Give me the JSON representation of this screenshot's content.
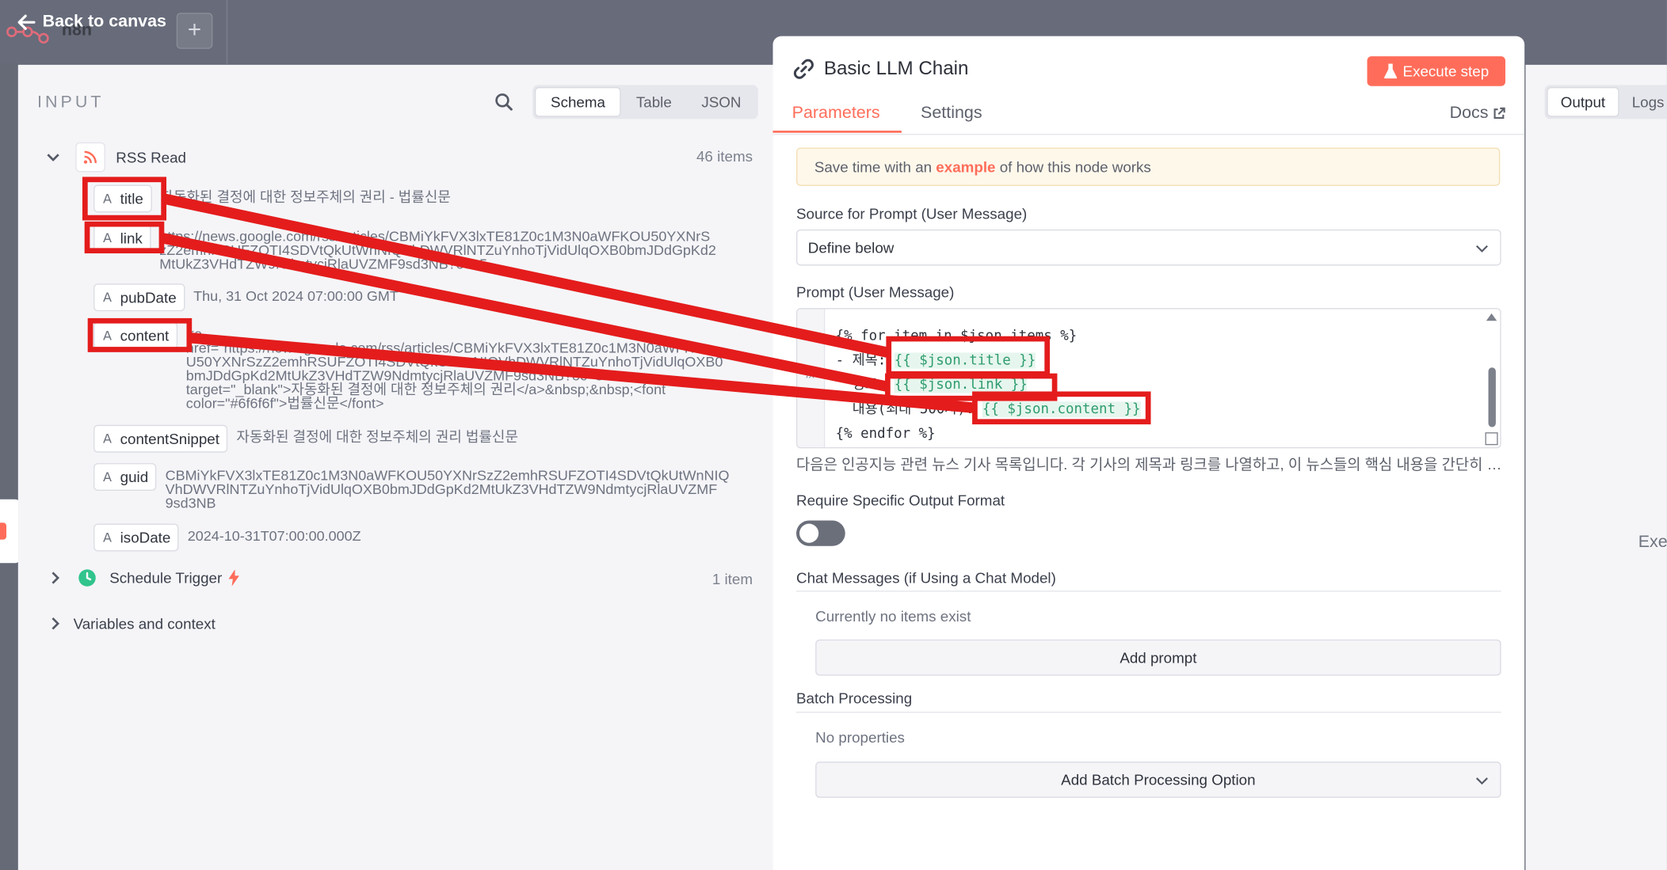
{
  "topbar": {
    "back_label": "Back to canvas",
    "app_name": "n8n",
    "plus_label": "+"
  },
  "input_panel": {
    "title": "INPUT",
    "view_tabs": [
      "Schema",
      "Table",
      "JSON"
    ],
    "active_view": "Schema",
    "rss": {
      "name": "RSS Read",
      "count": "46 items",
      "fields": [
        {
          "key": "title",
          "value": "자동화된 결정에 대한 정보주체의 권리 - 법률신문"
        },
        {
          "key": "link",
          "value": "https://news.google.com/rss/articles/CBMiYkFVX3lxTE81Z0c1M3N0aWFKOU50YXNrS\nzZ2emhRSUFZOTI4SDVtQkUtWnNIQVhDWVRlNTZuYnhoTjVidUlqOXB0bmJDdGpKd2\nMtUkZ3VHdTZW9NdmtycjRlaUVZMF9sd3NB?oc=5"
        },
        {
          "key": "pubDate",
          "value": "Thu, 31 Oct 2024 07:00:00 GMT"
        },
        {
          "key": "content",
          "value": "<a\nhref=\"https://news.google.com/rss/articles/CBMiYkFVX3lxTE81Z0c1M3N0aWFKO\nU50YXNrSzZ2emhRSUFZOTI4SDVtQkUtWnNIQVhDWVRlNTZuYnhoTjVidUlqOXB0\nbmJDdGpKd2MtUkZ3VHdTZW9NdmtycjRlaUVZMF9sd3NB?oc=5\"\ntarget=\"_blank\">자동화된 결정에 대한 정보주체의 권리</a>&nbsp;&nbsp;<font\ncolor=\"#6f6f6f\">법률신문</font>"
        },
        {
          "key": "contentSnippet",
          "value": "자동화된 결정에 대한 정보주체의 권리  법률신문"
        },
        {
          "key": "guid",
          "value": "CBMiYkFVX3lxTE81Z0c1M3N0aWFKOU50YXNrSzZ2emhRSUFZOTI4SDVtQkUtWnNIQ\nVhDWVRlNTZuYnhoTjVidUlqOXB0bmJDdGpKd2MtUkZ3VHdTZW9NdmtycjRlaUVZMF\n9sd3NB"
        },
        {
          "key": "isoDate",
          "value": "2024-10-31T07:00:00.000Z"
        }
      ]
    },
    "schedule": {
      "name": "Schedule Trigger",
      "count": "1 item"
    },
    "variables_label": "Variables and context"
  },
  "node": {
    "title": "Basic LLM Chain",
    "execute_label": "Execute step",
    "tabs": [
      "Parameters",
      "Settings"
    ],
    "docs_label": "Docs",
    "hint_prefix": "Save time with an ",
    "hint_link": "example",
    "hint_suffix": " of how this node works",
    "source_label": "Source for Prompt (User Message)",
    "source_value": "Define below",
    "prompt_label": "Prompt (User Message)",
    "code": {
      "line1": "{% for item in $json.items %}",
      "line2_prefix": "- 제목: ",
      "line2_expr": "{{ $json.title }}",
      "line3_prefix": "  링크: ",
      "line3_expr": "{{ $json.link }}",
      "line4_prefix": "  내용(최대 500자): ",
      "line4_expr": "{{ $json.content }}",
      "line5": "{% endfor %}"
    },
    "prompt_preview": "다음은 인공지능 관련 뉴스 기사 목록입니다. 각 기사의 제목과 링크를 나열하고, 이 뉴스들의 핵심 내용을 간단히 요약해 주세요.",
    "require_format_label": "Require Specific Output Format",
    "chat_messages_label": "Chat Messages (if Using a Chat Model)",
    "no_items": "Currently no items exist",
    "add_prompt": "Add prompt",
    "batch_label": "Batch Processing",
    "no_properties": "No properties",
    "add_batch": "Add Batch Processing Option"
  },
  "output_panel": {
    "tabs": [
      "Output",
      "Logs"
    ],
    "active": "Output",
    "exe_text": "Exe"
  },
  "colors": {
    "accent": "#ff6d5a",
    "annotation": "#e41c1c",
    "expression": "#2e9c6e"
  }
}
